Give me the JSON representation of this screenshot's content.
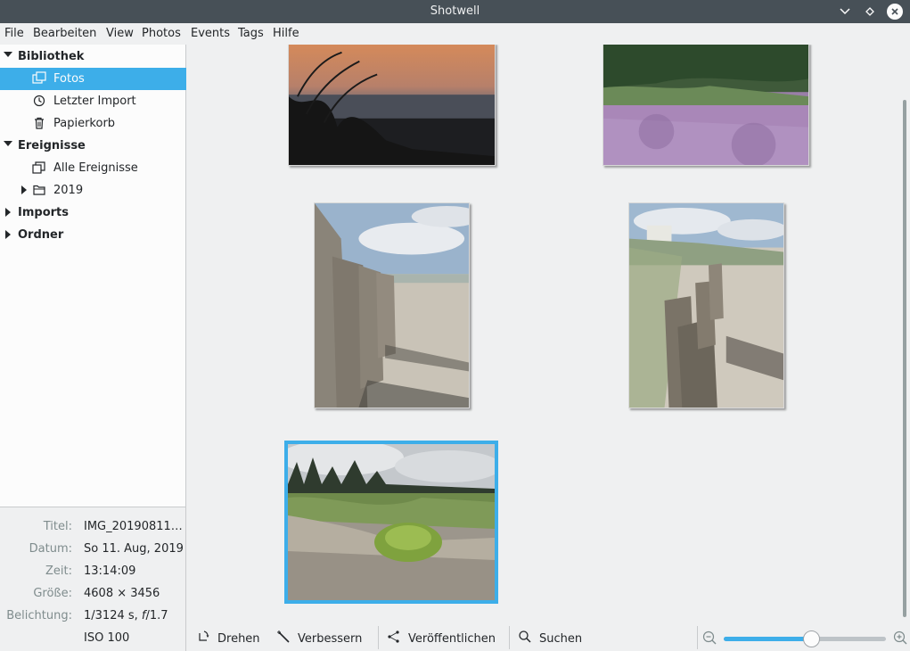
{
  "window": {
    "title": "Shotwell"
  },
  "menu": [
    "File",
    "Bearbeiten",
    "View",
    "Photos",
    "Events",
    "Tags",
    "Hilfe"
  ],
  "sidebar": {
    "library": {
      "label": "Bibliothek",
      "items": [
        "Fotos",
        "Letzter Import",
        "Papierkorb"
      ]
    },
    "events": {
      "label": "Ereignisse",
      "items": [
        "Alle Ereignisse",
        "2019"
      ]
    },
    "imports": "Imports",
    "folders": "Ordner",
    "selected": "Fotos"
  },
  "info": {
    "title_label": "Titel:",
    "title_value": "IMG_20190811_...",
    "date_label": "Datum:",
    "date_value": "So 11. Aug, 2019",
    "time_label": "Zeit:",
    "time_value": "13:14:09",
    "size_label": "Größe:",
    "size_value": "4608 × 3456",
    "exposure_label": "Belichtung:",
    "exposure_value_1": "1/3124 s, ",
    "exposure_fnum": "f",
    "exposure_value_2": "/1.7",
    "iso_value": "ISO 100"
  },
  "photos": [
    {
      "name": "sunset-grass"
    },
    {
      "name": "heather-field"
    },
    {
      "name": "beach-groynes-left"
    },
    {
      "name": "beach-groynes-right"
    },
    {
      "name": "dune-plant",
      "selected": true
    }
  ],
  "toolbar": {
    "rotate": "Drehen",
    "enhance": "Verbessern",
    "publish": "Veröffentlichen",
    "search": "Suchen",
    "zoom_level": 0.54
  },
  "colors": {
    "accent": "#3daee9",
    "titlebar": "#475057"
  }
}
